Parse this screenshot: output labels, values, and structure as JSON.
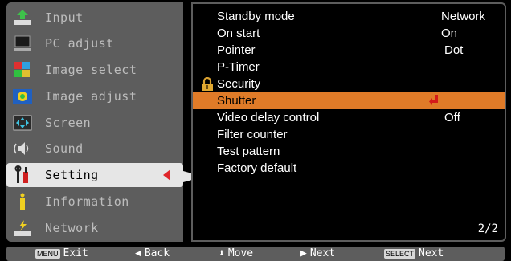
{
  "left_menu": [
    {
      "id": "input",
      "label": "Input",
      "icon": "input-icon"
    },
    {
      "id": "pc-adjust",
      "label": "PC adjust",
      "icon": "monitor-icon"
    },
    {
      "id": "image-select",
      "label": "Image select",
      "icon": "image-select-icon"
    },
    {
      "id": "image-adjust",
      "label": "Image adjust",
      "icon": "image-adjust-icon"
    },
    {
      "id": "screen",
      "label": "Screen",
      "icon": "screen-icon"
    },
    {
      "id": "sound",
      "label": "Sound",
      "icon": "speaker-icon"
    },
    {
      "id": "setting",
      "label": "Setting",
      "icon": "setting-tools-icon"
    },
    {
      "id": "information",
      "label": "Information",
      "icon": "info-icon"
    },
    {
      "id": "network",
      "label": "Network",
      "icon": "network-icon"
    }
  ],
  "settings": [
    {
      "name": "Standby mode",
      "value": "Network"
    },
    {
      "name": "On start",
      "value": "On"
    },
    {
      "name": "Pointer",
      "value": "Dot"
    },
    {
      "name": "P-Timer",
      "value": ""
    },
    {
      "name": "Security",
      "value": ""
    },
    {
      "name": "Shutter",
      "value": ""
    },
    {
      "name": "Video delay control",
      "value": "Off"
    },
    {
      "name": "Filter counter",
      "value": ""
    },
    {
      "name": "Test pattern",
      "value": ""
    },
    {
      "name": "Factory default",
      "value": ""
    }
  ],
  "page_indicator": "2/2",
  "bottom_bar": {
    "exit_key": "MENU",
    "exit_label": "Exit",
    "back_label": "Back",
    "move_label": "Move",
    "next_label": "Next",
    "select_key": "SELECT",
    "select_next_label": "Next"
  },
  "colors": {
    "menu_bg": "#5d5d5d",
    "highlight": "#e07b28",
    "selected_arrow": "#e0262b"
  }
}
